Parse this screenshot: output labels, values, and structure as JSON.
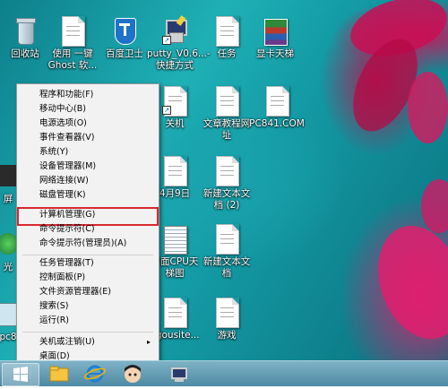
{
  "desktop_icons": [
    {
      "label": "回收站"
    },
    {
      "label": "使用 一键Ghost 软..."
    },
    {
      "label": "百度卫士"
    },
    {
      "label": "putty_V0.6...- 快捷方式"
    },
    {
      "label": "任务"
    },
    {
      "label": "显卡天梯"
    },
    {
      "label": "关机"
    },
    {
      "label": "文章教程网址"
    },
    {
      "label": "PC841.COM"
    },
    {
      "label": "4月9日"
    },
    {
      "label": "新建文本文档 (2)"
    },
    {
      "label": "桌面CPU天梯图"
    },
    {
      "label": "新建文本文档"
    },
    {
      "label": "ogousite..."
    },
    {
      "label": "游戏"
    },
    {
      "label": "屏"
    },
    {
      "label": "光"
    },
    {
      "label": "pc8"
    }
  ],
  "context_menu": {
    "items": [
      {
        "label": "程序和功能(F)"
      },
      {
        "label": "移动中心(B)"
      },
      {
        "label": "电源选项(O)"
      },
      {
        "label": "事件查看器(V)"
      },
      {
        "label": "系统(Y)"
      },
      {
        "label": "设备管理器(M)"
      },
      {
        "label": "网络连接(W)"
      },
      {
        "label": "磁盘管理(K)"
      },
      {
        "label": "计算机管理(G)"
      },
      {
        "label": "命令提示符(C)"
      },
      {
        "label": "命令提示符(管理员)(A)"
      },
      {
        "label": "任务管理器(T)"
      },
      {
        "label": "控制面板(P)"
      },
      {
        "label": "文件资源管理器(E)"
      },
      {
        "label": "搜索(S)"
      },
      {
        "label": "运行(R)"
      },
      {
        "label": "关机或注销(U)"
      },
      {
        "label": "桌面(D)"
      }
    ],
    "submenu_arrow": "▸",
    "highlight_color": "#d9272e"
  },
  "taskbar": {
    "start_icon": "windows-logo-icon",
    "pinned": [
      "file-explorer-icon",
      "internet-explorer-icon",
      "character-app-icon",
      "network-tool-icon"
    ]
  },
  "colors": {
    "taskbar": "#5f9bb3",
    "menu_bg": "#f2f2f2",
    "accent": "#d9272e"
  }
}
